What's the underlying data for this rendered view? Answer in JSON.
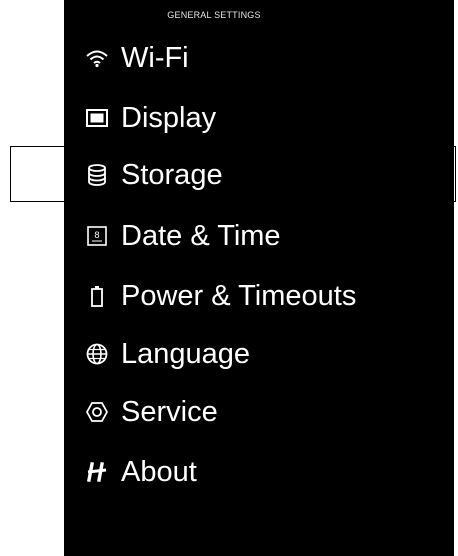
{
  "header": {
    "title": "GENERAL SETTINGS"
  },
  "menu": {
    "items": [
      {
        "label": "Wi-Fi",
        "icon": "wifi-icon"
      },
      {
        "label": "Display",
        "icon": "display-icon"
      },
      {
        "label": "Storage",
        "icon": "storage-icon",
        "selected": true
      },
      {
        "label": "Date & Time",
        "icon": "calendar-icon",
        "icon_text": "8"
      },
      {
        "label": "Power & Timeouts",
        "icon": "battery-icon"
      },
      {
        "label": "Language",
        "icon": "globe-icon"
      },
      {
        "label": "Service",
        "icon": "service-icon"
      },
      {
        "label": "About",
        "icon": "brand-h-icon"
      }
    ]
  },
  "colors": {
    "background": "#000000",
    "text": "#ffffff",
    "page": "#ffffff",
    "selection_border": "#000000"
  }
}
